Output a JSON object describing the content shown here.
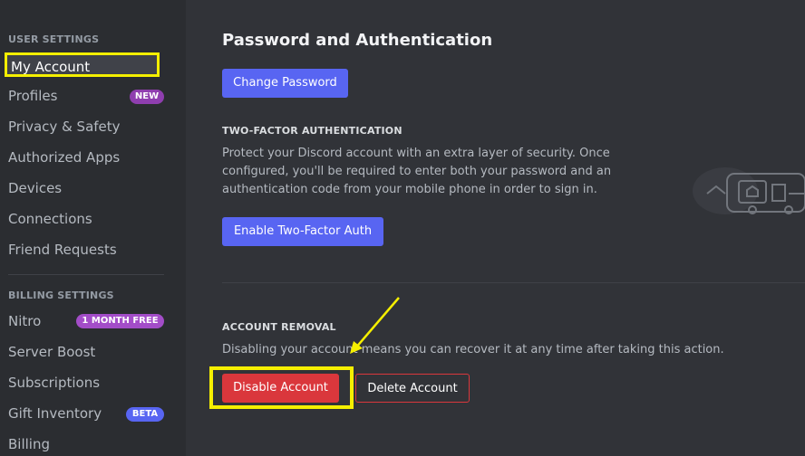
{
  "sidebar": {
    "user_settings_header": "USER SETTINGS",
    "items": [
      {
        "label": "My Account"
      },
      {
        "label": "Profiles",
        "badge": "NEW"
      },
      {
        "label": "Privacy & Safety"
      },
      {
        "label": "Authorized Apps"
      },
      {
        "label": "Devices"
      },
      {
        "label": "Connections"
      },
      {
        "label": "Friend Requests"
      }
    ],
    "billing_header": "BILLING SETTINGS",
    "billing_items": [
      {
        "label": "Nitro",
        "badge": "1 MONTH FREE"
      },
      {
        "label": "Server Boost"
      },
      {
        "label": "Subscriptions"
      },
      {
        "label": "Gift Inventory",
        "badge": "BETA"
      },
      {
        "label": "Billing"
      }
    ]
  },
  "main": {
    "title": "Password and Authentication",
    "change_password_label": "Change Password",
    "two_factor": {
      "header": "TWO-FACTOR AUTHENTICATION",
      "description": "Protect your Discord account with an extra layer of security. Once configured, you'll be required to enter both your password and an authentication code from your mobile phone in order to sign in.",
      "enable_label": "Enable Two-Factor Auth"
    },
    "account_removal": {
      "header": "ACCOUNT REMOVAL",
      "description": "Disabling your account means you can recover it at any time after taking this action.",
      "disable_label": "Disable Account",
      "delete_label": "Delete Account"
    }
  },
  "colors": {
    "accent": "#5865f2",
    "danger": "#da373c",
    "annotation": "#f5ef00",
    "new_badge": "#8f3eaf",
    "nitro_badge": "#a34dc8",
    "beta_badge": "#5865f2"
  }
}
